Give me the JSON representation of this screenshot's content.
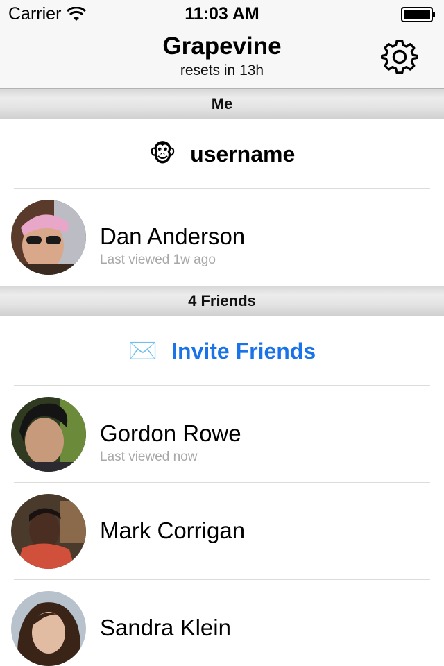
{
  "status_bar": {
    "carrier": "Carrier",
    "time": "11:03 AM"
  },
  "nav": {
    "title": "Grapevine",
    "subtitle": "resets in 13h",
    "settings_icon": "gear-icon"
  },
  "me_section": {
    "header": "Me",
    "username_emoji": "🐵",
    "username": "username",
    "profile": {
      "name": "Dan Anderson",
      "last_viewed": "Last viewed 1w ago"
    }
  },
  "friends_section": {
    "header": "4 Friends",
    "invite_emoji": "✉️",
    "invite_label": "Invite Friends",
    "friends": [
      {
        "name": "Gordon Rowe",
        "last_viewed": "Last viewed now"
      },
      {
        "name": "Mark Corrigan",
        "last_viewed": ""
      },
      {
        "name": "Sandra Klein",
        "last_viewed": ""
      }
    ]
  },
  "colors": {
    "accent": "#1a73e8",
    "bar_bg": "#f7f7f7",
    "secondary_text": "#a8a8a8"
  }
}
